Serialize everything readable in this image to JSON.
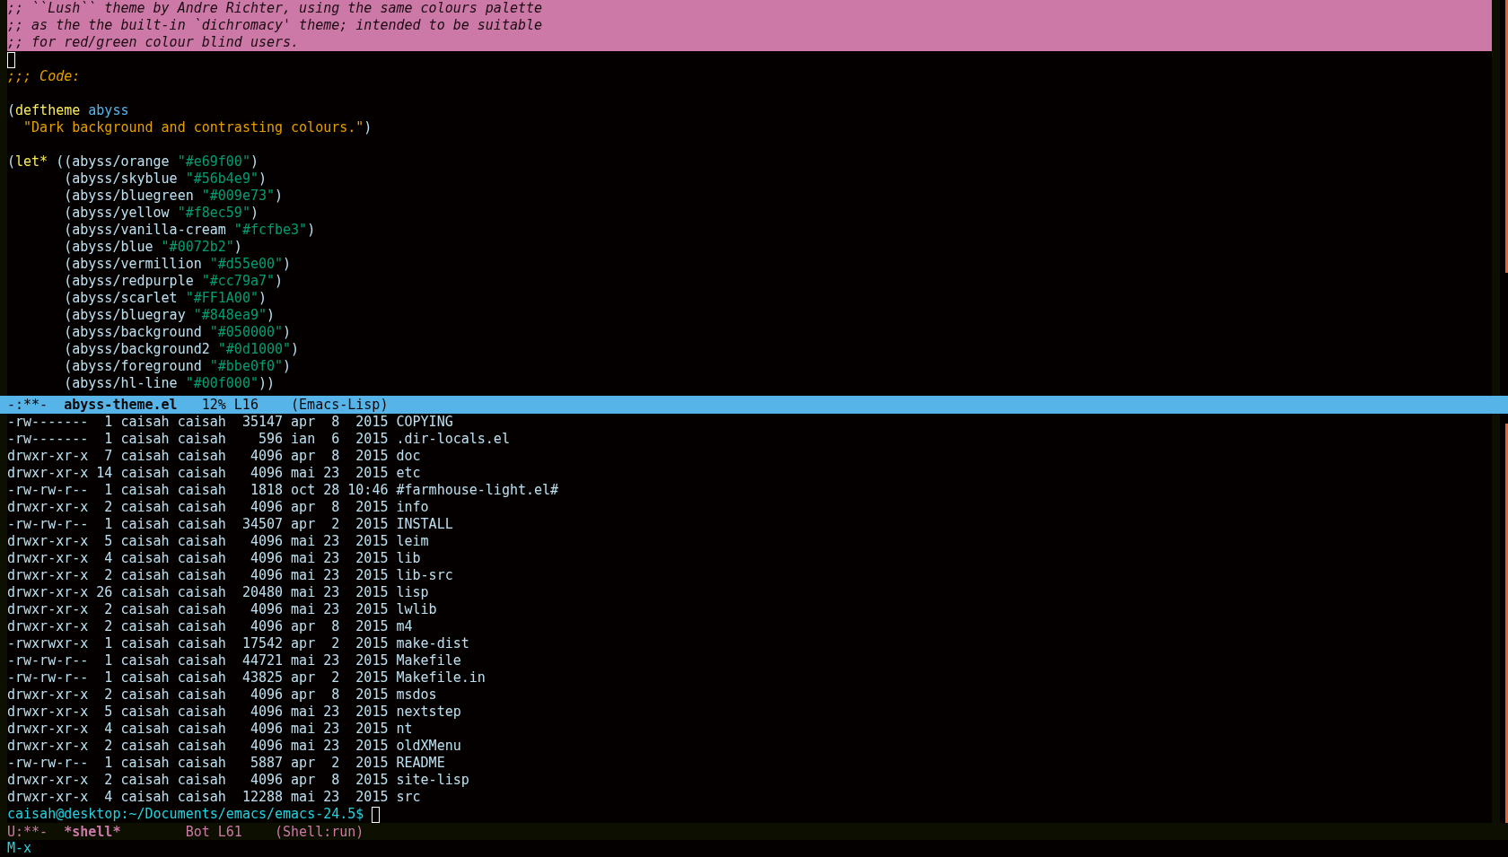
{
  "editor": {
    "lines": [
      {
        "kind": "highlighted-comment",
        "tokens": [
          {
            "kind": "comment",
            "text": ";; ``Lush`` theme by Andre Richter, using the same colours palette"
          }
        ]
      },
      {
        "kind": "highlighted-comment",
        "tokens": [
          {
            "kind": "comment",
            "text": ";; as the the built-in `dichromacy' theme; intended to be suitable"
          }
        ]
      },
      {
        "kind": "highlighted-comment",
        "tokens": [
          {
            "kind": "comment",
            "text": ";; for red/green colour blind users."
          }
        ]
      },
      {
        "kind": "code",
        "tokens": [
          {
            "kind": "cursor"
          }
        ]
      },
      {
        "kind": "code",
        "tokens": [
          {
            "kind": "heading-comment",
            "text": ";;; Code:"
          }
        ]
      },
      {
        "kind": "blank"
      },
      {
        "kind": "code",
        "tokens": [
          {
            "kind": "plain",
            "text": "("
          },
          {
            "kind": "keyword",
            "text": "deftheme"
          },
          {
            "kind": "name",
            "text": "abyss"
          }
        ]
      },
      {
        "kind": "docstring",
        "tokens": [
          {
            "kind": "string",
            "text": "\"Dark background and contrasting colours.\""
          },
          {
            "kind": "plain",
            "text": ")"
          }
        ]
      },
      {
        "kind": "blank"
      },
      {
        "kind": "code",
        "tokens": [
          {
            "kind": "plain",
            "text": "("
          },
          {
            "kind": "keyword",
            "text": "let*"
          },
          {
            "kind": "plain",
            "text": " ((abyss/orange "
          },
          {
            "kind": "color-string",
            "text": "\"#e69f00\""
          },
          {
            "kind": "plain",
            "text": ")"
          }
        ]
      },
      {
        "kind": "binding",
        "tokens": [
          {
            "kind": "plain",
            "text": "(abyss/skyblue "
          },
          {
            "kind": "color-string",
            "text": "\"#56b4e9\""
          },
          {
            "kind": "plain",
            "text": ")"
          }
        ]
      },
      {
        "kind": "binding",
        "tokens": [
          {
            "kind": "plain",
            "text": "(abyss/bluegreen "
          },
          {
            "kind": "color-string",
            "text": "\"#009e73\""
          },
          {
            "kind": "plain",
            "text": ")"
          }
        ]
      },
      {
        "kind": "binding",
        "tokens": [
          {
            "kind": "plain",
            "text": "(abyss/yellow "
          },
          {
            "kind": "color-string",
            "text": "\"#f8ec59\""
          },
          {
            "kind": "plain",
            "text": ")"
          }
        ]
      },
      {
        "kind": "binding",
        "tokens": [
          {
            "kind": "plain",
            "text": "(abyss/vanilla-cream "
          },
          {
            "kind": "color-string",
            "text": "\"#fcfbe3\""
          },
          {
            "kind": "plain",
            "text": ")"
          }
        ]
      },
      {
        "kind": "binding",
        "tokens": [
          {
            "kind": "plain",
            "text": "(abyss/blue "
          },
          {
            "kind": "color-string",
            "text": "\"#0072b2\""
          },
          {
            "kind": "plain",
            "text": ")"
          }
        ]
      },
      {
        "kind": "binding",
        "tokens": [
          {
            "kind": "plain",
            "text": "(abyss/vermillion "
          },
          {
            "kind": "color-string",
            "text": "\"#d55e00\""
          },
          {
            "kind": "plain",
            "text": ")"
          }
        ]
      },
      {
        "kind": "binding",
        "tokens": [
          {
            "kind": "plain",
            "text": "(abyss/redpurple "
          },
          {
            "kind": "color-string",
            "text": "\"#cc79a7\""
          },
          {
            "kind": "plain",
            "text": ")"
          }
        ]
      },
      {
        "kind": "binding",
        "tokens": [
          {
            "kind": "plain",
            "text": "(abyss/scarlet "
          },
          {
            "kind": "color-string",
            "text": "\"#FF1A00\""
          },
          {
            "kind": "plain",
            "text": ")"
          }
        ]
      },
      {
        "kind": "binding",
        "tokens": [
          {
            "kind": "plain",
            "text": "(abyss/bluegray "
          },
          {
            "kind": "color-string",
            "text": "\"#848ea9\""
          },
          {
            "kind": "plain",
            "text": ")"
          }
        ]
      },
      {
        "kind": "binding",
        "tokens": [
          {
            "kind": "plain",
            "text": "(abyss/background "
          },
          {
            "kind": "color-string",
            "text": "\"#050000\""
          },
          {
            "kind": "plain",
            "text": ")"
          }
        ]
      },
      {
        "kind": "binding",
        "tokens": [
          {
            "kind": "plain",
            "text": "(abyss/background2 "
          },
          {
            "kind": "color-string",
            "text": "\"#0d1000\""
          },
          {
            "kind": "plain",
            "text": ")"
          }
        ]
      },
      {
        "kind": "binding",
        "tokens": [
          {
            "kind": "plain",
            "text": "(abyss/foreground "
          },
          {
            "kind": "color-string",
            "text": "\"#bbe0f0\""
          },
          {
            "kind": "plain",
            "text": ")"
          }
        ]
      },
      {
        "kind": "binding",
        "tokens": [
          {
            "kind": "plain",
            "text": "(abyss/hl-line "
          },
          {
            "kind": "color-string",
            "text": "\"#00f000\""
          },
          {
            "kind": "plain",
            "text": "))"
          }
        ]
      }
    ]
  },
  "editor_mode_line": {
    "active": true,
    "segments": [
      "-:**-",
      "abyss-theme.el",
      "12% L16",
      "(Emacs-Lisp)"
    ]
  },
  "shell": {
    "lines": [
      {
        "tokens": [
          {
            "kind": "plain",
            "text": "-rw-------  1 caisah caisah  35147 apr  8  2015 COPYING"
          }
        ]
      },
      {
        "tokens": [
          {
            "kind": "plain",
            "text": "-rw-------  1 caisah caisah    596 ian  6  2015 .dir-locals.el"
          }
        ]
      },
      {
        "tokens": [
          {
            "kind": "plain",
            "text": "drwxr-xr-x  7 caisah caisah   4096 apr  8  2015 doc"
          }
        ]
      },
      {
        "tokens": [
          {
            "kind": "plain",
            "text": "drwxr-xr-x 14 caisah caisah   4096 mai 23  2015 etc"
          }
        ]
      },
      {
        "tokens": [
          {
            "kind": "plain",
            "text": "-rw-rw-r--  1 caisah caisah   1818 oct 28 10:46 #farmhouse-light.el#"
          }
        ]
      },
      {
        "tokens": [
          {
            "kind": "plain",
            "text": "drwxr-xr-x  2 caisah caisah   4096 apr  8  2015 info"
          }
        ]
      },
      {
        "tokens": [
          {
            "kind": "plain",
            "text": "-rw-rw-r--  1 caisah caisah  34507 apr  2  2015 INSTALL"
          }
        ]
      },
      {
        "tokens": [
          {
            "kind": "plain",
            "text": "drwxr-xr-x  5 caisah caisah   4096 mai 23  2015 leim"
          }
        ]
      },
      {
        "tokens": [
          {
            "kind": "plain",
            "text": "drwxr-xr-x  4 caisah caisah   4096 mai 23  2015 lib"
          }
        ]
      },
      {
        "tokens": [
          {
            "kind": "plain",
            "text": "drwxr-xr-x  2 caisah caisah   4096 mai 23  2015 lib-src"
          }
        ]
      },
      {
        "tokens": [
          {
            "kind": "plain",
            "text": "drwxr-xr-x 26 caisah caisah  20480 mai 23  2015 lisp"
          }
        ]
      },
      {
        "tokens": [
          {
            "kind": "plain",
            "text": "drwxr-xr-x  2 caisah caisah   4096 mai 23  2015 lwlib"
          }
        ]
      },
      {
        "tokens": [
          {
            "kind": "plain",
            "text": "drwxr-xr-x  2 caisah caisah   4096 apr  8  2015 m4"
          }
        ]
      },
      {
        "tokens": [
          {
            "kind": "plain",
            "text": "-rwxrwxr-x  1 caisah caisah  17542 apr  2  2015 make-dist"
          }
        ]
      },
      {
        "tokens": [
          {
            "kind": "plain",
            "text": "-rw-rw-r--  1 caisah caisah  44721 mai 23  2015 Makefile"
          }
        ]
      },
      {
        "tokens": [
          {
            "kind": "plain",
            "text": "-rw-rw-r--  1 caisah caisah  43825 apr  2  2015 Makefile.in"
          }
        ]
      },
      {
        "tokens": [
          {
            "kind": "plain",
            "text": "drwxr-xr-x  2 caisah caisah   4096 apr  8  2015 msdos"
          }
        ]
      },
      {
        "tokens": [
          {
            "kind": "plain",
            "text": "drwxr-xr-x  5 caisah caisah   4096 mai 23  2015 nextstep"
          }
        ]
      },
      {
        "tokens": [
          {
            "kind": "plain",
            "text": "drwxr-xr-x  4 caisah caisah   4096 mai 23  2015 nt"
          }
        ]
      },
      {
        "tokens": [
          {
            "kind": "plain",
            "text": "drwxr-xr-x  2 caisah caisah   4096 mai 23  2015 oldXMenu"
          }
        ]
      },
      {
        "tokens": [
          {
            "kind": "plain",
            "text": "-rw-rw-r--  1 caisah caisah   5887 apr  2  2015 README"
          }
        ]
      },
      {
        "tokens": [
          {
            "kind": "plain",
            "text": "drwxr-xr-x  2 caisah caisah   4096 apr  8  2015 site-lisp"
          }
        ]
      },
      {
        "tokens": [
          {
            "kind": "plain",
            "text": "drwxr-xr-x  4 caisah caisah  12288 mai 23  2015 src"
          }
        ]
      },
      {
        "tokens": [
          {
            "kind": "prompt",
            "text": "caisah@desktop:~/Documents/emacs/emacs-24.5$"
          },
          {
            "kind": "cursor"
          }
        ]
      }
    ]
  },
  "shell_mode_line": {
    "active": false,
    "segments": [
      "U:**-",
      "*shell*",
      "Bot L61",
      "(Shell:run)"
    ]
  },
  "minibuffer": {
    "text": "M-x"
  }
}
